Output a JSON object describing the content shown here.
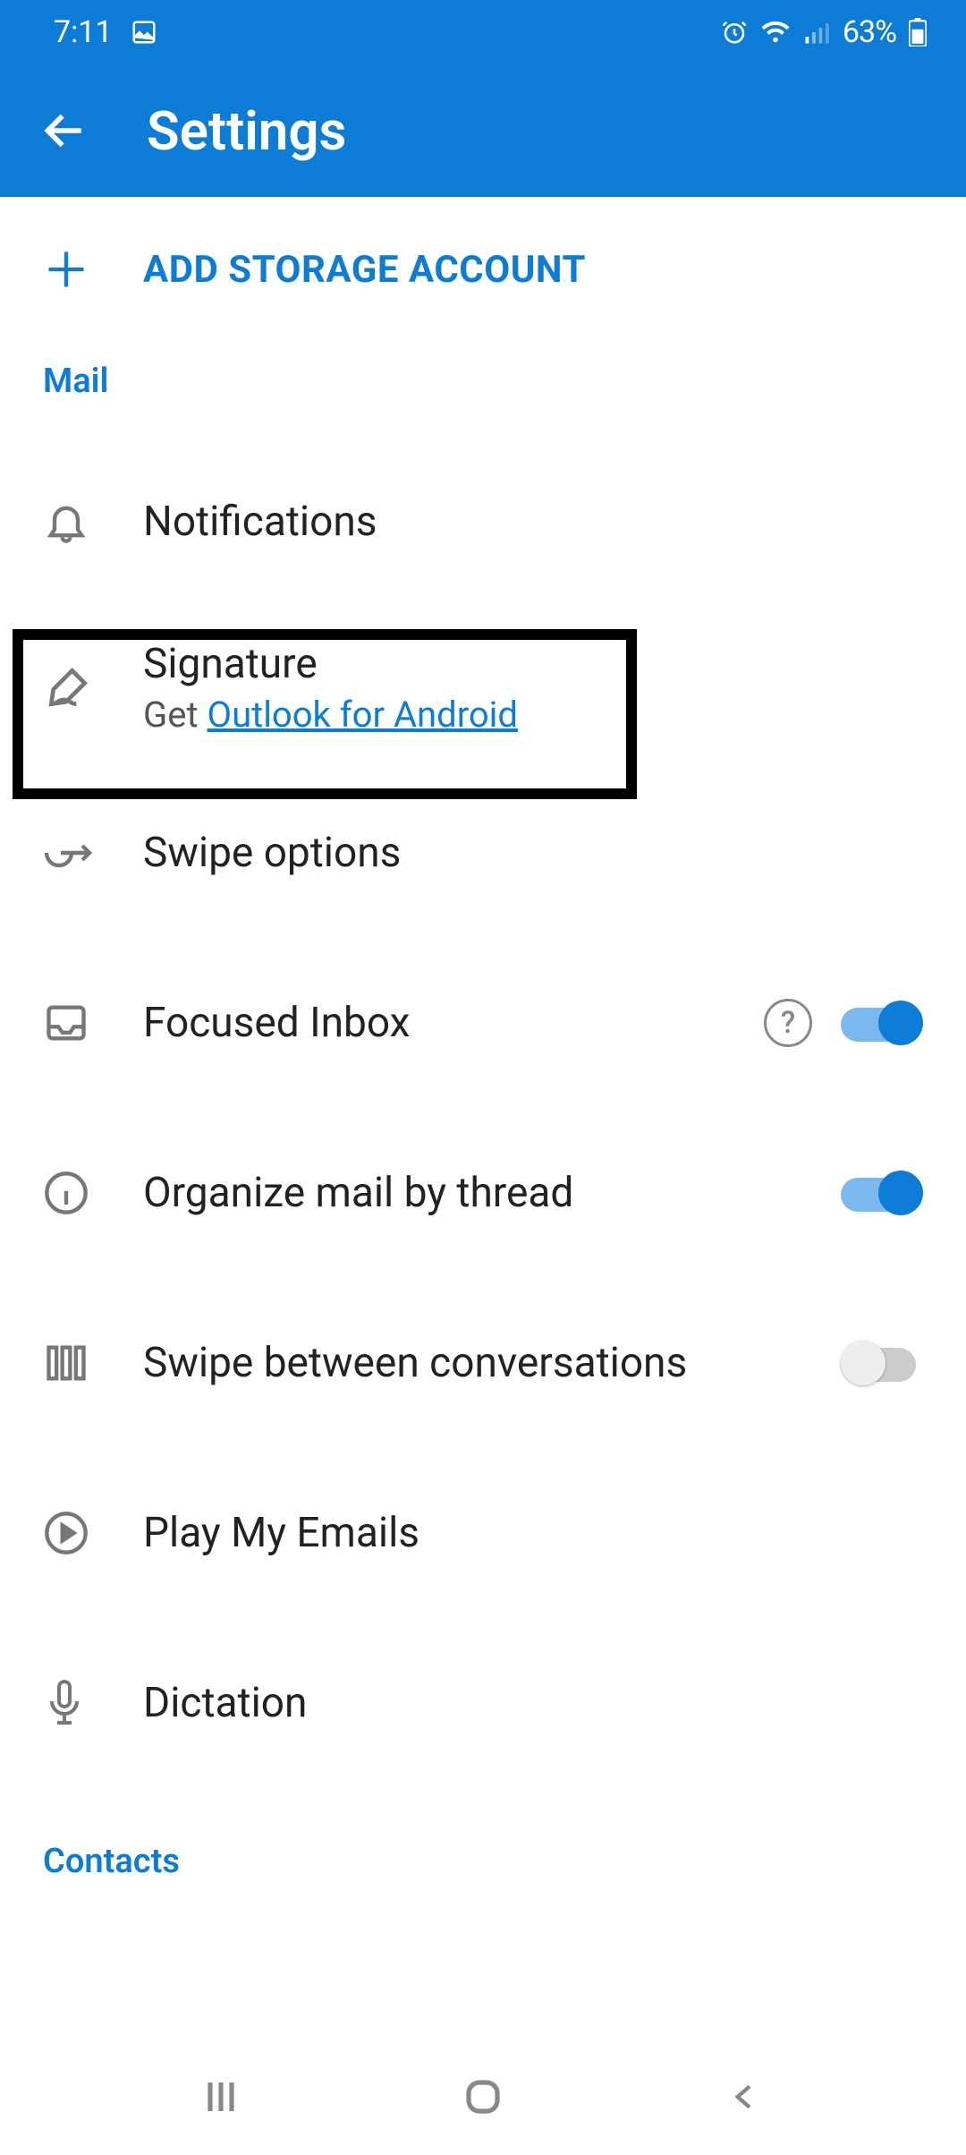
{
  "status": {
    "time": "7:11",
    "battery": "63%"
  },
  "header": {
    "title": "Settings"
  },
  "add_storage": {
    "label": "ADD STORAGE ACCOUNT"
  },
  "sections": {
    "mail": {
      "label": "Mail",
      "items": {
        "notifications": {
          "title": "Notifications"
        },
        "signature": {
          "title": "Signature",
          "sub_prefix": "Get",
          "sub_link": "Outlook for Android"
        },
        "swipe_options": {
          "title": "Swipe options"
        },
        "focused_inbox": {
          "title": "Focused Inbox",
          "toggle": true
        },
        "organize_thread": {
          "title": "Organize mail by thread",
          "toggle": true
        },
        "swipe_conv": {
          "title": "Swipe between conversations",
          "toggle": false
        },
        "play_emails": {
          "title": "Play My Emails"
        },
        "dictation": {
          "title": "Dictation"
        }
      }
    },
    "contacts": {
      "label": "Contacts"
    }
  }
}
